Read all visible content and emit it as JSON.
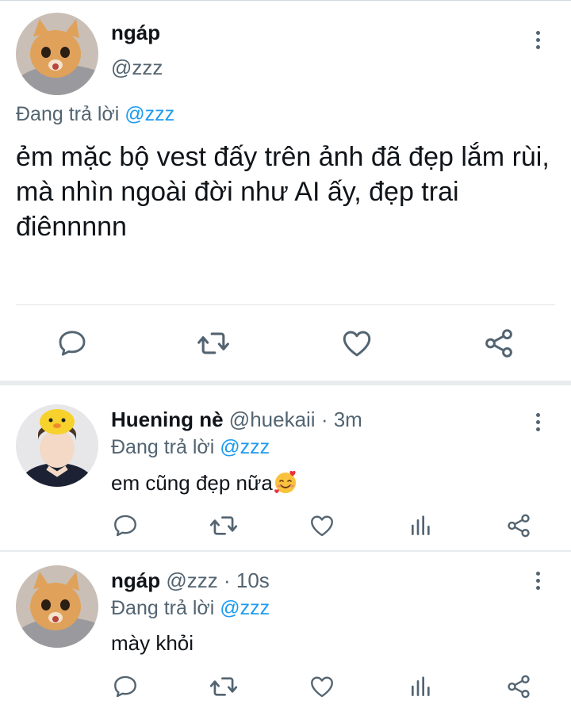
{
  "main_tweet": {
    "name": "ngáp",
    "handle": "@zzz",
    "replying_prefix": "Đang trả lời",
    "replying_to": "@zzz",
    "text": "ẻm mặc bộ vest đấy trên ảnh đã đẹp lắm rùi, mà nhìn ngoài đời như AI ấy, đẹp trai điênnnnn",
    "actions": [
      "reply-icon",
      "retweet-icon",
      "like-icon",
      "share-icon"
    ]
  },
  "replies": [
    {
      "name": "Huening nè",
      "handle": "@huekaii",
      "time_sep": " · ",
      "time": "3m",
      "replying_prefix": "Đang trả lời",
      "replying_to": "@zzz",
      "text": "em cũng đẹp nữa",
      "emoji": "smiling-face-with-hearts"
    },
    {
      "name": "ngáp",
      "handle": "@zzz",
      "time_sep": " · ",
      "time": "10s",
      "replying_prefix": "Đang trả lời",
      "replying_to": "@zzz",
      "text": "mày khỏi"
    }
  ],
  "colors": {
    "accent": "#1d9bf0",
    "secondary_text": "#536471",
    "icon": "#536471",
    "divider": "#dfe5e8"
  }
}
